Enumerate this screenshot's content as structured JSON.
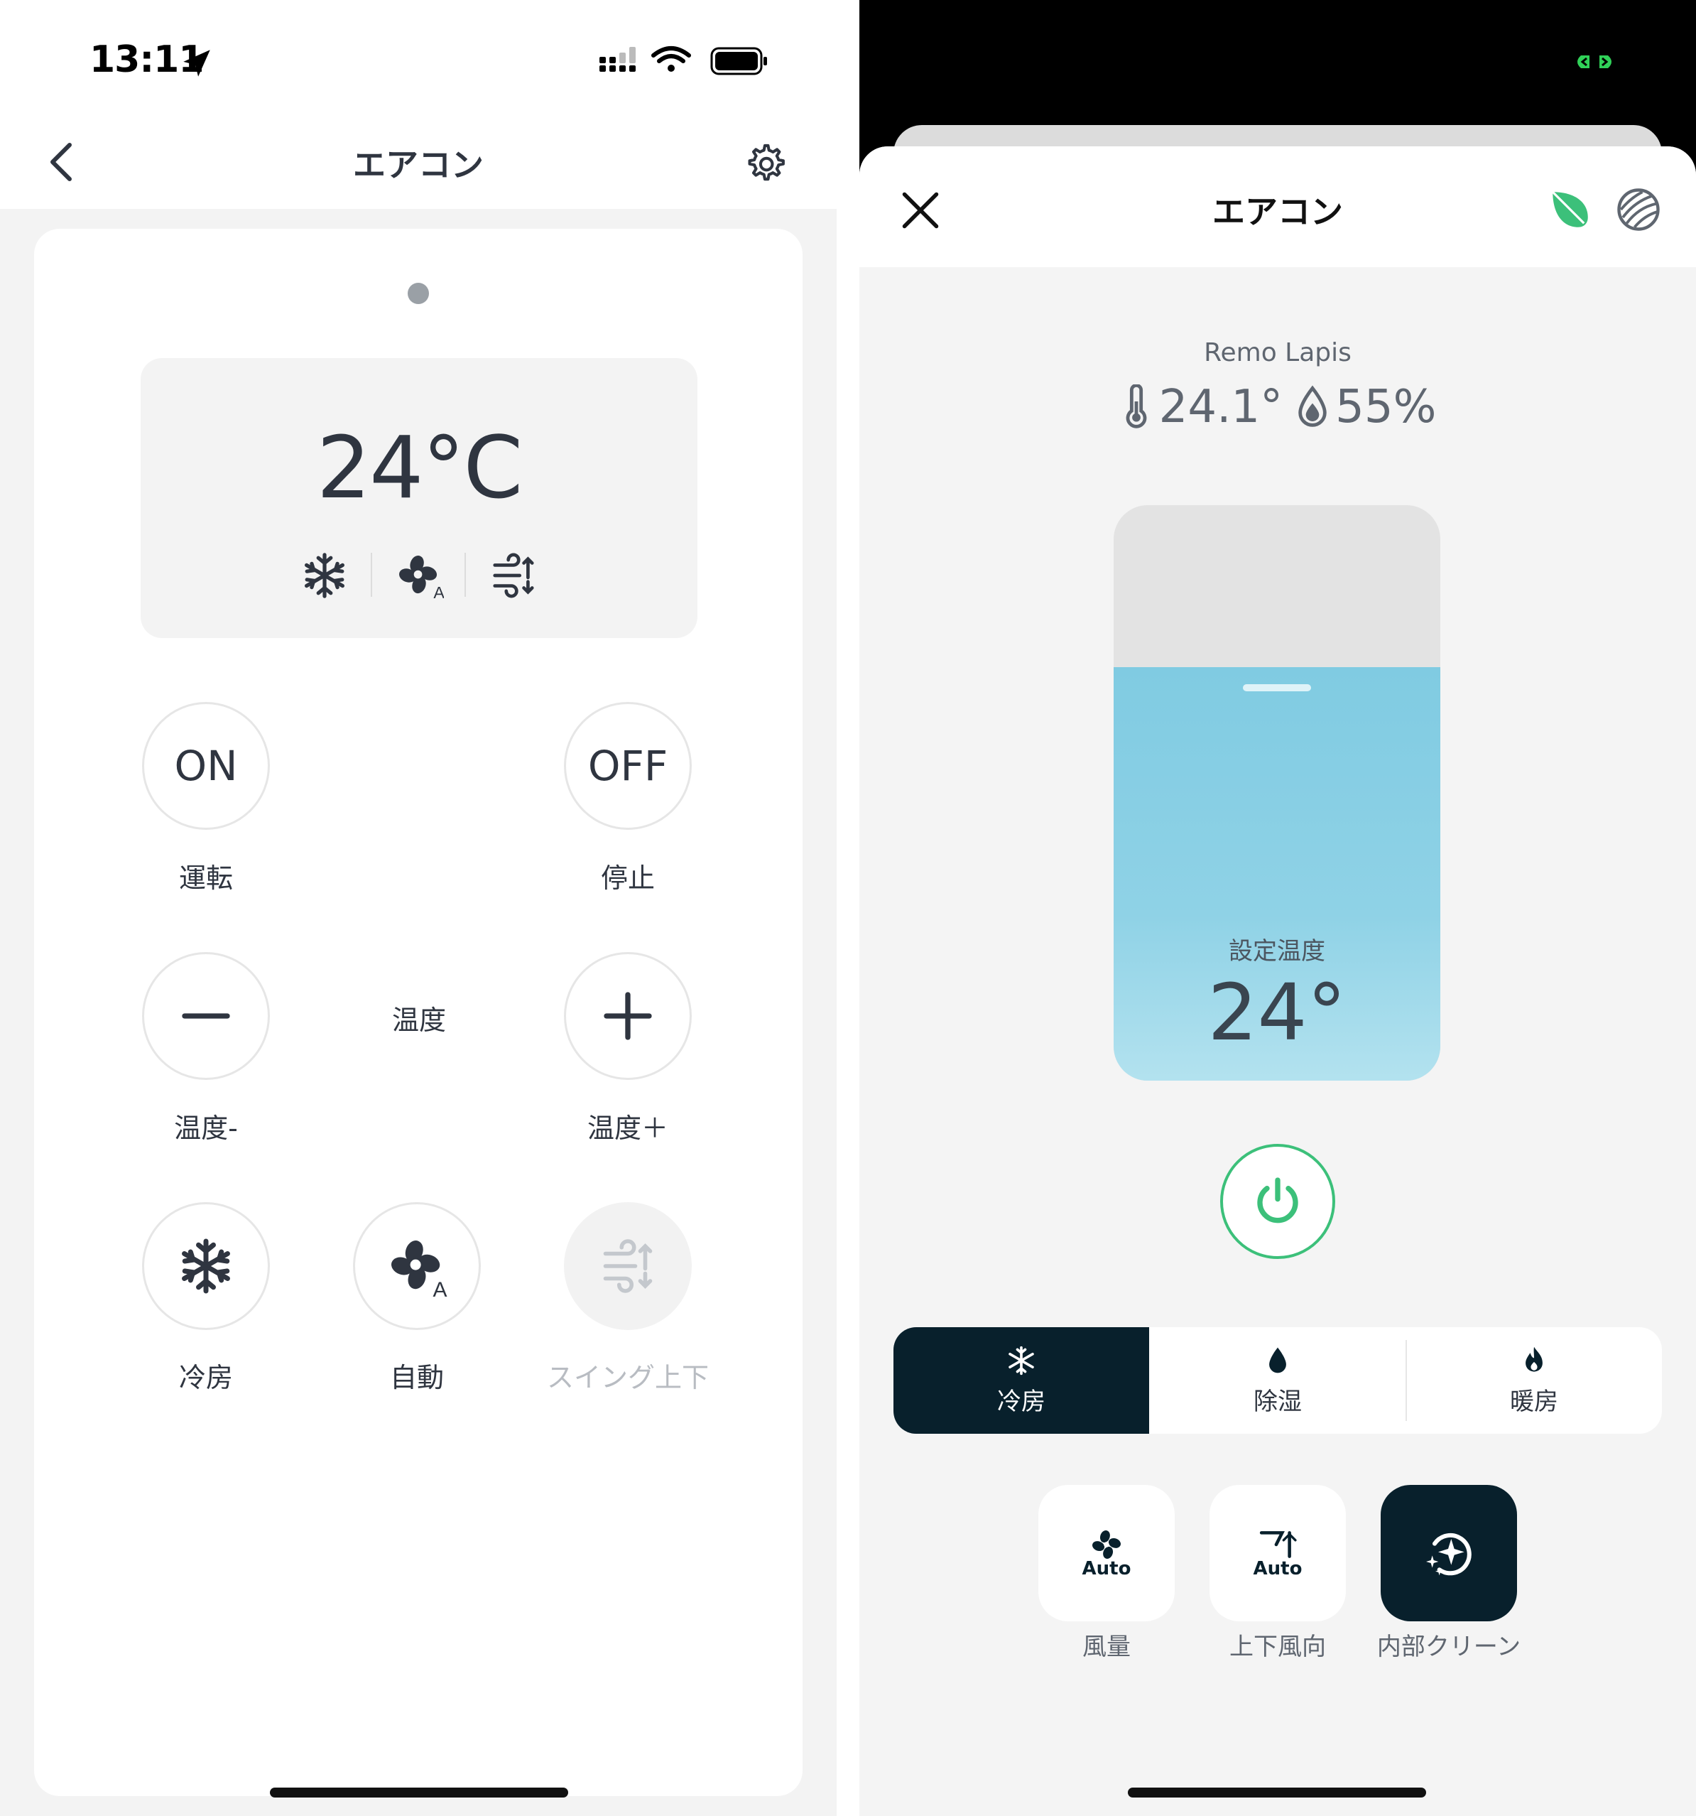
{
  "left": {
    "status_bar": {
      "time": "13:11"
    },
    "nav": {
      "title": "エアコン"
    },
    "display": {
      "temperature": "24°C"
    },
    "buttons": {
      "on": {
        "text": "ON",
        "label": "運転"
      },
      "off": {
        "text": "OFF",
        "label": "停止"
      },
      "temp_minus": {
        "label": "温度-"
      },
      "temp_center": {
        "label": "温度"
      },
      "temp_plus": {
        "label": "温度＋"
      },
      "cool": {
        "label": "冷房"
      },
      "auto": {
        "label": "自動"
      },
      "swing": {
        "label": "スイング上下"
      }
    }
  },
  "right": {
    "header": {
      "title": "エアコン"
    },
    "device": {
      "name": "Remo Lapis",
      "temperature": "24.1°",
      "humidity": "55%"
    },
    "thermostat": {
      "label": "設定温度",
      "value": "24°"
    },
    "modes": [
      {
        "label": "冷房",
        "icon": "snowflake-icon",
        "active": true
      },
      {
        "label": "除湿",
        "icon": "droplet-icon",
        "active": false
      },
      {
        "label": "暖房",
        "icon": "flame-icon",
        "active": false
      }
    ],
    "tiles": [
      {
        "badge": "Auto",
        "label": "風量",
        "icon": "fan-icon"
      },
      {
        "badge": "Auto",
        "label": "上下風向",
        "icon": "louver-icon"
      },
      {
        "badge": "",
        "label": "内部クリーン",
        "icon": "clean-icon"
      }
    ],
    "colors": {
      "accent_green": "#3cc07a",
      "active_mode": "#08202c",
      "thermostat_blue": "#80cbe2"
    }
  }
}
